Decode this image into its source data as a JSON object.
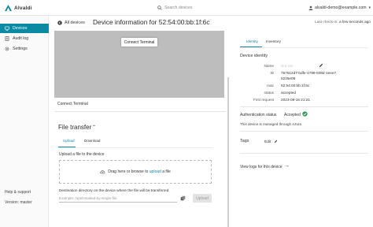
{
  "app": {
    "name": "Alvaldi",
    "brand_color": "#0b8aa3",
    "search_placeholder": "Search devices",
    "user_email": "alvaldi-demo@example.com"
  },
  "sidebar": {
    "items": [
      {
        "label": "Devices",
        "icon": "devices-icon",
        "active": true
      },
      {
        "label": "Audit log",
        "icon": "audit-log-icon",
        "active": false
      },
      {
        "label": "Settings",
        "icon": "gear-icon",
        "active": false
      }
    ],
    "footer": {
      "help": "Help & support",
      "version": "Version: master"
    }
  },
  "header": {
    "back_label": "All devices",
    "title": "Device information for 52:54:00:bb:1f:6c",
    "last_checkin_label": "Last check-in:",
    "last_checkin_value": "a few seconds ago"
  },
  "terminal": {
    "connect_button": "Connect Terminal",
    "section_label": "Connect Terminal"
  },
  "file_transfer": {
    "title": "File transfer",
    "tabs": [
      "Upload",
      "Download"
    ],
    "active_tab": "Upload",
    "upload_label": "Upload a file to the device",
    "drop_prefix": "Drag here or browse to",
    "drop_link": "upload",
    "drop_suffix": "a file",
    "destination_label": "Destination directory on the device where the file will be transferred",
    "destination_placeholder": "Example: /opt/installed-by-single-file",
    "upload_button": "Upload"
  },
  "details": {
    "tabs": [
      "Identity",
      "Inventory"
    ],
    "active_tab": "Identity",
    "identity_title": "Device identity",
    "fields": {
      "name_key": "Name",
      "name_value": "Not set",
      "id_key": "ID",
      "id_value_line1": "767512d7-bdfe-4799-839d-1eee7",
      "id_value_line2": "6225e08",
      "mac_key": "mac",
      "mac_value": "52:54:00:bb:1f:6c",
      "status_key": "status",
      "status_value": "accepted",
      "first_request_key": "First request",
      "first_request_value": "2023-08-16 21:21"
    },
    "auth_label": "Authentication status",
    "auth_value": "Accepted",
    "azure_note": "This device is managed through Azure.",
    "tags_label": "Tags",
    "tags_edit": "Edit",
    "view_logs": "View logs for this device"
  }
}
